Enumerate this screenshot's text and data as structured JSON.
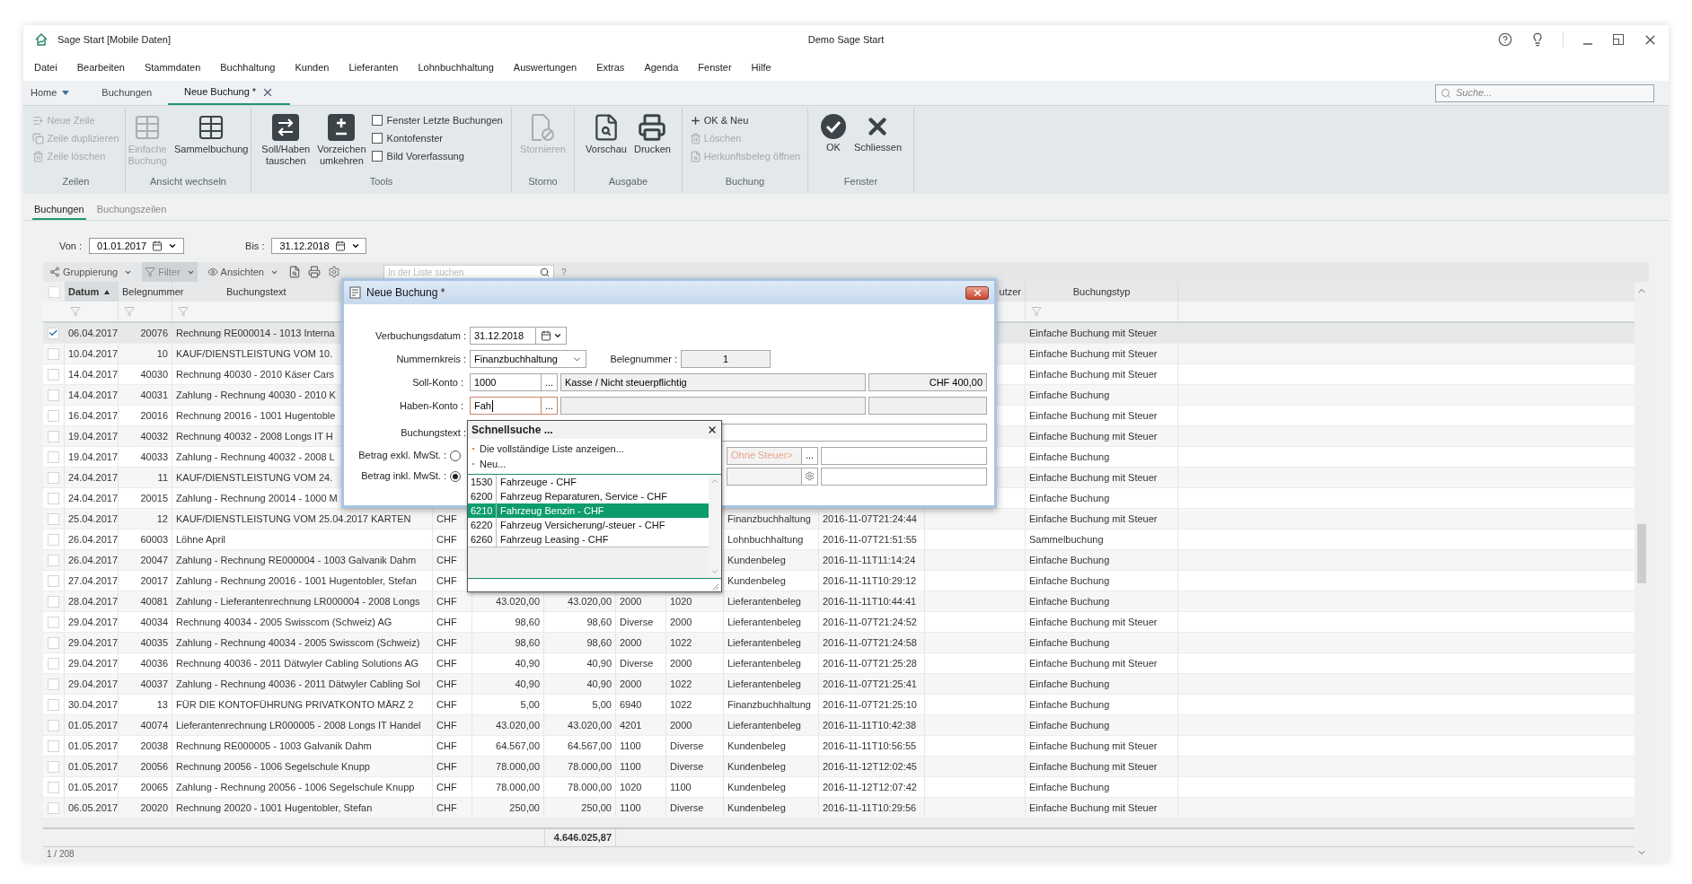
{
  "window": {
    "title": "Sage Start [Mobile Daten]",
    "center_title": "Demo Sage Start"
  },
  "menu": [
    "Datei",
    "Bearbeiten",
    "Stammdaten",
    "Buchhaltung",
    "Kunden",
    "Lieferanten",
    "Lohnbuchhaltung",
    "Auswertungen",
    "Extras",
    "Agenda",
    "Fenster",
    "Hilfe"
  ],
  "tabs": [
    {
      "label": "Home",
      "kind": "dropdown",
      "selected": false
    },
    {
      "label": "Buchungen",
      "kind": "plain",
      "selected": false
    },
    {
      "label": "Neue Buchung *",
      "kind": "closable",
      "selected": true
    }
  ],
  "search": {
    "placeholder": "Suche..."
  },
  "ribbon": [
    {
      "label": "Zeilen",
      "items": [
        {
          "kind": "small",
          "label": "Neue Zeile",
          "disabled": true
        },
        {
          "kind": "small",
          "label": "Zeile duplizieren",
          "disabled": true
        },
        {
          "kind": "small",
          "label": "Zeile löschen",
          "disabled": true
        }
      ]
    },
    {
      "label": "Ansicht wechseln",
      "items": [
        {
          "kind": "large",
          "label": "Einfache Buchung",
          "disabled": true
        },
        {
          "kind": "large",
          "label": "Sammelbuchung",
          "disabled": false
        }
      ]
    },
    {
      "label": "Tools",
      "items": [
        {
          "kind": "large",
          "label": "Soll/Haben tauschen",
          "disabled": false
        },
        {
          "kind": "large",
          "label": "Vorzeichen umkehren",
          "disabled": false
        },
        {
          "kind": "checkbox",
          "label": "Fenster Letzte Buchungen",
          "checked": false
        },
        {
          "kind": "checkbox",
          "label": "Kontofenster",
          "checked": false
        },
        {
          "kind": "checkbox",
          "label": "Bild Vorerfassung",
          "checked": false
        }
      ]
    },
    {
      "label": "Storno",
      "items": [
        {
          "kind": "large",
          "label": "Stornieren",
          "disabled": true
        }
      ]
    },
    {
      "label": "Ausgabe",
      "items": [
        {
          "kind": "large",
          "label": "Vorschau",
          "disabled": false
        },
        {
          "kind": "large",
          "label": "Drucken",
          "disabled": false
        }
      ]
    },
    {
      "label": "Buchung",
      "items": [
        {
          "kind": "small",
          "label": "OK & Neu",
          "disabled": false
        },
        {
          "kind": "small",
          "label": "Löschen",
          "disabled": true
        },
        {
          "kind": "small",
          "label": "Herkunftsbeleg öffnen",
          "disabled": true
        }
      ]
    },
    {
      "label": "Fenster",
      "items": [
        {
          "kind": "large",
          "label": "OK",
          "disabled": false
        },
        {
          "kind": "large",
          "label": "Schliessen",
          "disabled": false
        }
      ]
    }
  ],
  "subtabs": [
    {
      "label": "Buchungen",
      "selected": true
    },
    {
      "label": "Buchungszeilen",
      "selected": false
    }
  ],
  "date_filter": {
    "from_label": "Von :",
    "from": "01.01.2017",
    "to_label": "Bis :",
    "to": "31.12.2018"
  },
  "list_toolbar": {
    "buttons": [
      {
        "label": "Gruppierung",
        "selected": false
      },
      {
        "label": "Filter",
        "selected": true
      },
      {
        "label": "Ansichten",
        "selected": false
      }
    ],
    "search_placeholder": "In der Liste suchen",
    "help": "?"
  },
  "table": {
    "all_checked": false,
    "columns": [
      {
        "label": "Datum",
        "sorted": true
      },
      {
        "label": "Belegnummer",
        "sorted": false
      },
      {
        "label": "Buchungstext",
        "sorted": false
      },
      {
        "label": "utzer",
        "sorted": false
      },
      {
        "label": "Buchungstyp",
        "sorted": false
      }
    ],
    "rows": [
      {
        "checked": true,
        "date": "06.04.2017",
        "number": "20076",
        "text": "Rechnung RE000014 - 1013 Interna",
        "type": "Einfache Buchung mit Steuer"
      },
      {
        "checked": false,
        "date": "10.04.2017",
        "number": "10",
        "text": "KAUF/DIENSTLEISTUNG VOM 10.",
        "type": "Einfache Buchung mit Steuer"
      },
      {
        "checked": false,
        "date": "14.04.2017",
        "number": "40030",
        "text": "Rechnung 40030 - 2010 Käser Cars",
        "type": "Einfache Buchung mit Steuer"
      },
      {
        "checked": false,
        "date": "14.04.2017",
        "number": "40031",
        "text": "Zahlung - Rechnung 40030 - 2010 K",
        "type": "Einfache Buchung"
      },
      {
        "checked": false,
        "date": "16.04.2017",
        "number": "20016",
        "text": "Rechnung 20016 - 1001 Hugentoble",
        "type": "Einfache Buchung mit Steuer"
      },
      {
        "checked": false,
        "date": "19.04.2017",
        "number": "40032",
        "text": "Rechnung 40032 - 2008 Longs IT H",
        "type": "Einfache Buchung mit Steuer"
      },
      {
        "checked": false,
        "date": "19.04.2017",
        "number": "40033",
        "text": "Zahlung - Rechnung 40032 - 2008 L",
        "type": "Einfache Buchung"
      },
      {
        "checked": false,
        "date": "24.04.2017",
        "number": "11",
        "text": "KAUF/DIENSTLEISTUNG VOM 24.",
        "type": "Einfache Buchung mit Steuer"
      },
      {
        "checked": false,
        "date": "24.04.2017",
        "number": "20015",
        "text": "Zahlung - Rechnung 20014 - 1000 M",
        "type": "Einfache Buchung"
      },
      {
        "checked": false,
        "date": "25.04.2017",
        "number": "12",
        "text": "KAUF/DIENSTLEISTUNG VOM 25.04.2017 KARTEN",
        "currency": "CHF",
        "document_type": "Finanzbuchhaltung",
        "timestamp": "2016-11-07T21:24:44",
        "type": "Einfache Buchung mit Steuer"
      },
      {
        "checked": false,
        "date": "26.04.2017",
        "number": "60003",
        "text": "Löhne April",
        "currency": "CHF",
        "document_type": "Lohnbuchhaltung",
        "timestamp": "2016-11-07T21:51:55",
        "type": "Sammelbuchung"
      },
      {
        "checked": false,
        "date": "26.04.2017",
        "number": "20047",
        "text": "Zahlung - Rechnung RE000004 - 1003 Galvanik Dahm",
        "currency": "CHF",
        "document_type": "Kundenbeleg",
        "timestamp": "2016-11-11T11:14:24",
        "type": "Einfache Buchung"
      },
      {
        "checked": false,
        "date": "27.04.2017",
        "number": "20017",
        "text": "Zahlung - Rechnung 20016 - 1001 Hugentobler, Stefan",
        "currency": "CHF",
        "document_type": "Kundenbeleg",
        "timestamp": "2016-11-11T10:29:12",
        "type": "Einfache Buchung"
      },
      {
        "checked": false,
        "date": "28.04.2017",
        "number": "40081",
        "text": "Zahlung - Lieferantenrechnung LR000004 - 2008 Longs",
        "currency": "CHF",
        "amount": "43.020,00",
        "amount_2": "43.020,00",
        "account_1": "2000",
        "account_2": "1020",
        "document_type": "Lieferantenbeleg",
        "timestamp": "2016-11-11T10:44:41",
        "type": "Einfache Buchung"
      },
      {
        "checked": false,
        "date": "29.04.2017",
        "number": "40034",
        "text": "Rechnung 40034 - 2005 Swisscom (Schweiz) AG",
        "currency": "CHF",
        "amount": "98,60",
        "amount_2": "98,60",
        "account_1": "Diverse",
        "account_2": "2000",
        "document_type": "Lieferantenbeleg",
        "timestamp": "2016-11-07T21:24:52",
        "type": "Einfache Buchung mit Steuer"
      },
      {
        "checked": false,
        "date": "29.04.2017",
        "number": "40035",
        "text": "Zahlung - Rechnung 40034 - 2005 Swisscom (Schweiz)",
        "currency": "CHF",
        "amount": "98,60",
        "amount_2": "98,60",
        "account_1": "2000",
        "account_2": "1022",
        "document_type": "Lieferantenbeleg",
        "timestamp": "2016-11-07T21:24:58",
        "type": "Einfache Buchung"
      },
      {
        "checked": false,
        "date": "29.04.2017",
        "number": "40036",
        "text": "Rechnung 40036 - 2011 Dätwyler Cabling Solutions AG",
        "currency": "CHF",
        "amount": "40,90",
        "amount_2": "40,90",
        "account_1": "Diverse",
        "account_2": "2000",
        "document_type": "Lieferantenbeleg",
        "timestamp": "2016-11-07T21:25:28",
        "type": "Einfache Buchung mit Steuer"
      },
      {
        "checked": false,
        "date": "29.04.2017",
        "number": "40037",
        "text": "Zahlung - Rechnung 40036 - 2011 Dätwyler Cabling Sol",
        "currency": "CHF",
        "amount": "40,90",
        "amount_2": "40,90",
        "account_1": "2000",
        "account_2": "1022",
        "document_type": "Lieferantenbeleg",
        "timestamp": "2016-11-07T21:25:41",
        "type": "Einfache Buchung"
      },
      {
        "checked": false,
        "date": "30.04.2017",
        "number": "13",
        "text": "FÜR DIE KONTOFÜHRUNG PRIVATKONTO MÄRZ 2",
        "currency": "CHF",
        "amount": "5,00",
        "amount_2": "5,00",
        "account_1": "6940",
        "account_2": "1022",
        "document_type": "Finanzbuchhaltung",
        "timestamp": "2016-11-07T21:25:10",
        "type": "Einfache Buchung"
      },
      {
        "checked": false,
        "date": "01.05.2017",
        "number": "40074",
        "text": "Lieferantenrechnung LR000005 - 2008 Longs IT Handel",
        "currency": "CHF",
        "amount": "43.020,00",
        "amount_2": "43.020,00",
        "account_1": "4201",
        "account_2": "2000",
        "document_type": "Lieferantenbeleg",
        "timestamp": "2016-11-11T10:42:38",
        "type": "Einfache Buchung"
      },
      {
        "checked": false,
        "date": "01.05.2017",
        "number": "20038",
        "text": "Rechnung RE000005 - 1003 Galvanik Dahm",
        "currency": "CHF",
        "amount": "64.567,00",
        "amount_2": "64.567,00",
        "account_1": "1100",
        "account_2": "Diverse",
        "document_type": "Kundenbeleg",
        "timestamp": "2016-11-11T10:56:55",
        "type": "Einfache Buchung mit Steuer"
      },
      {
        "checked": false,
        "date": "01.05.2017",
        "number": "20056",
        "text": "Rechnung 20056 - 1006 Segelschule Knupp",
        "currency": "CHF",
        "amount": "78.000,00",
        "amount_2": "78.000,00",
        "account_1": "1100",
        "account_2": "Diverse",
        "document_type": "Kundenbeleg",
        "timestamp": "2016-11-12T12:02:45",
        "type": "Einfache Buchung mit Steuer"
      },
      {
        "checked": false,
        "date": "01.05.2017",
        "number": "20065",
        "text": "Zahlung - Rechnung 20056 - 1006 Segelschule Knupp",
        "currency": "CHF",
        "amount": "78.000,00",
        "amount_2": "78.000,00",
        "account_1": "1020",
        "account_2": "1100",
        "document_type": "Kundenbeleg",
        "timestamp": "2016-11-12T12:07:42",
        "type": "Einfache Buchung"
      },
      {
        "checked": false,
        "date": "06.05.2017",
        "number": "20020",
        "text": "Rechnung 20020 - 1001 Hugentobler, Stefan",
        "currency": "CHF",
        "amount": "250,00",
        "amount_2": "250,00",
        "account_1": "1100",
        "account_2": "Diverse",
        "document_type": "Kundenbeleg",
        "timestamp": "2016-11-11T10:29:56",
        "type": "Einfache Buchung mit Steuer"
      }
    ],
    "total": "4.646.025,87",
    "position": "1 / 208"
  },
  "dialog": {
    "title": "Neue Buchung *",
    "date": {
      "label": "Verbuchungsdatum :",
      "value": "31.12.2018"
    },
    "number_range": {
      "label": "Nummernkreis :",
      "value": "Finanzbuchhaltung"
    },
    "document_number": {
      "label": "Belegnummer :",
      "value": "1"
    },
    "debit": {
      "label": "Soll-Konto :",
      "value": "1000",
      "browse": "...",
      "name": "Kasse / Nicht steuerpflichtig",
      "balance": "CHF 400,00"
    },
    "credit": {
      "label": "Haben-Konto :",
      "value": "Fah",
      "browse": "..."
    },
    "text": {
      "label": "Buchungstext :"
    },
    "amount_excl": {
      "label": "Betrag exkl. MwSt. :",
      "selected": false,
      "tax": "Ohne Steuer>",
      "browse": "..."
    },
    "amount_incl": {
      "label": "Betrag inkl. MwSt. :",
      "selected": true
    }
  },
  "quick_search": {
    "title": "Schnellsuche ...",
    "links": [
      "Die vollständige Liste anzeigen...",
      "Neu..."
    ],
    "results": [
      {
        "code": "1530",
        "name": "Fahrzeuge - CHF",
        "selected": false
      },
      {
        "code": "6200",
        "name": "Fahrzeug Reparaturen, Service - CHF",
        "selected": false
      },
      {
        "code": "6210",
        "name": "Fahrzeug Benzin - CHF",
        "selected": true
      },
      {
        "code": "6220",
        "name": "Fahrzeug Versicherung/-steuer - CHF",
        "selected": false
      },
      {
        "code": "6260",
        "name": "Fahrzeug Leasing - CHF",
        "selected": false
      }
    ]
  }
}
